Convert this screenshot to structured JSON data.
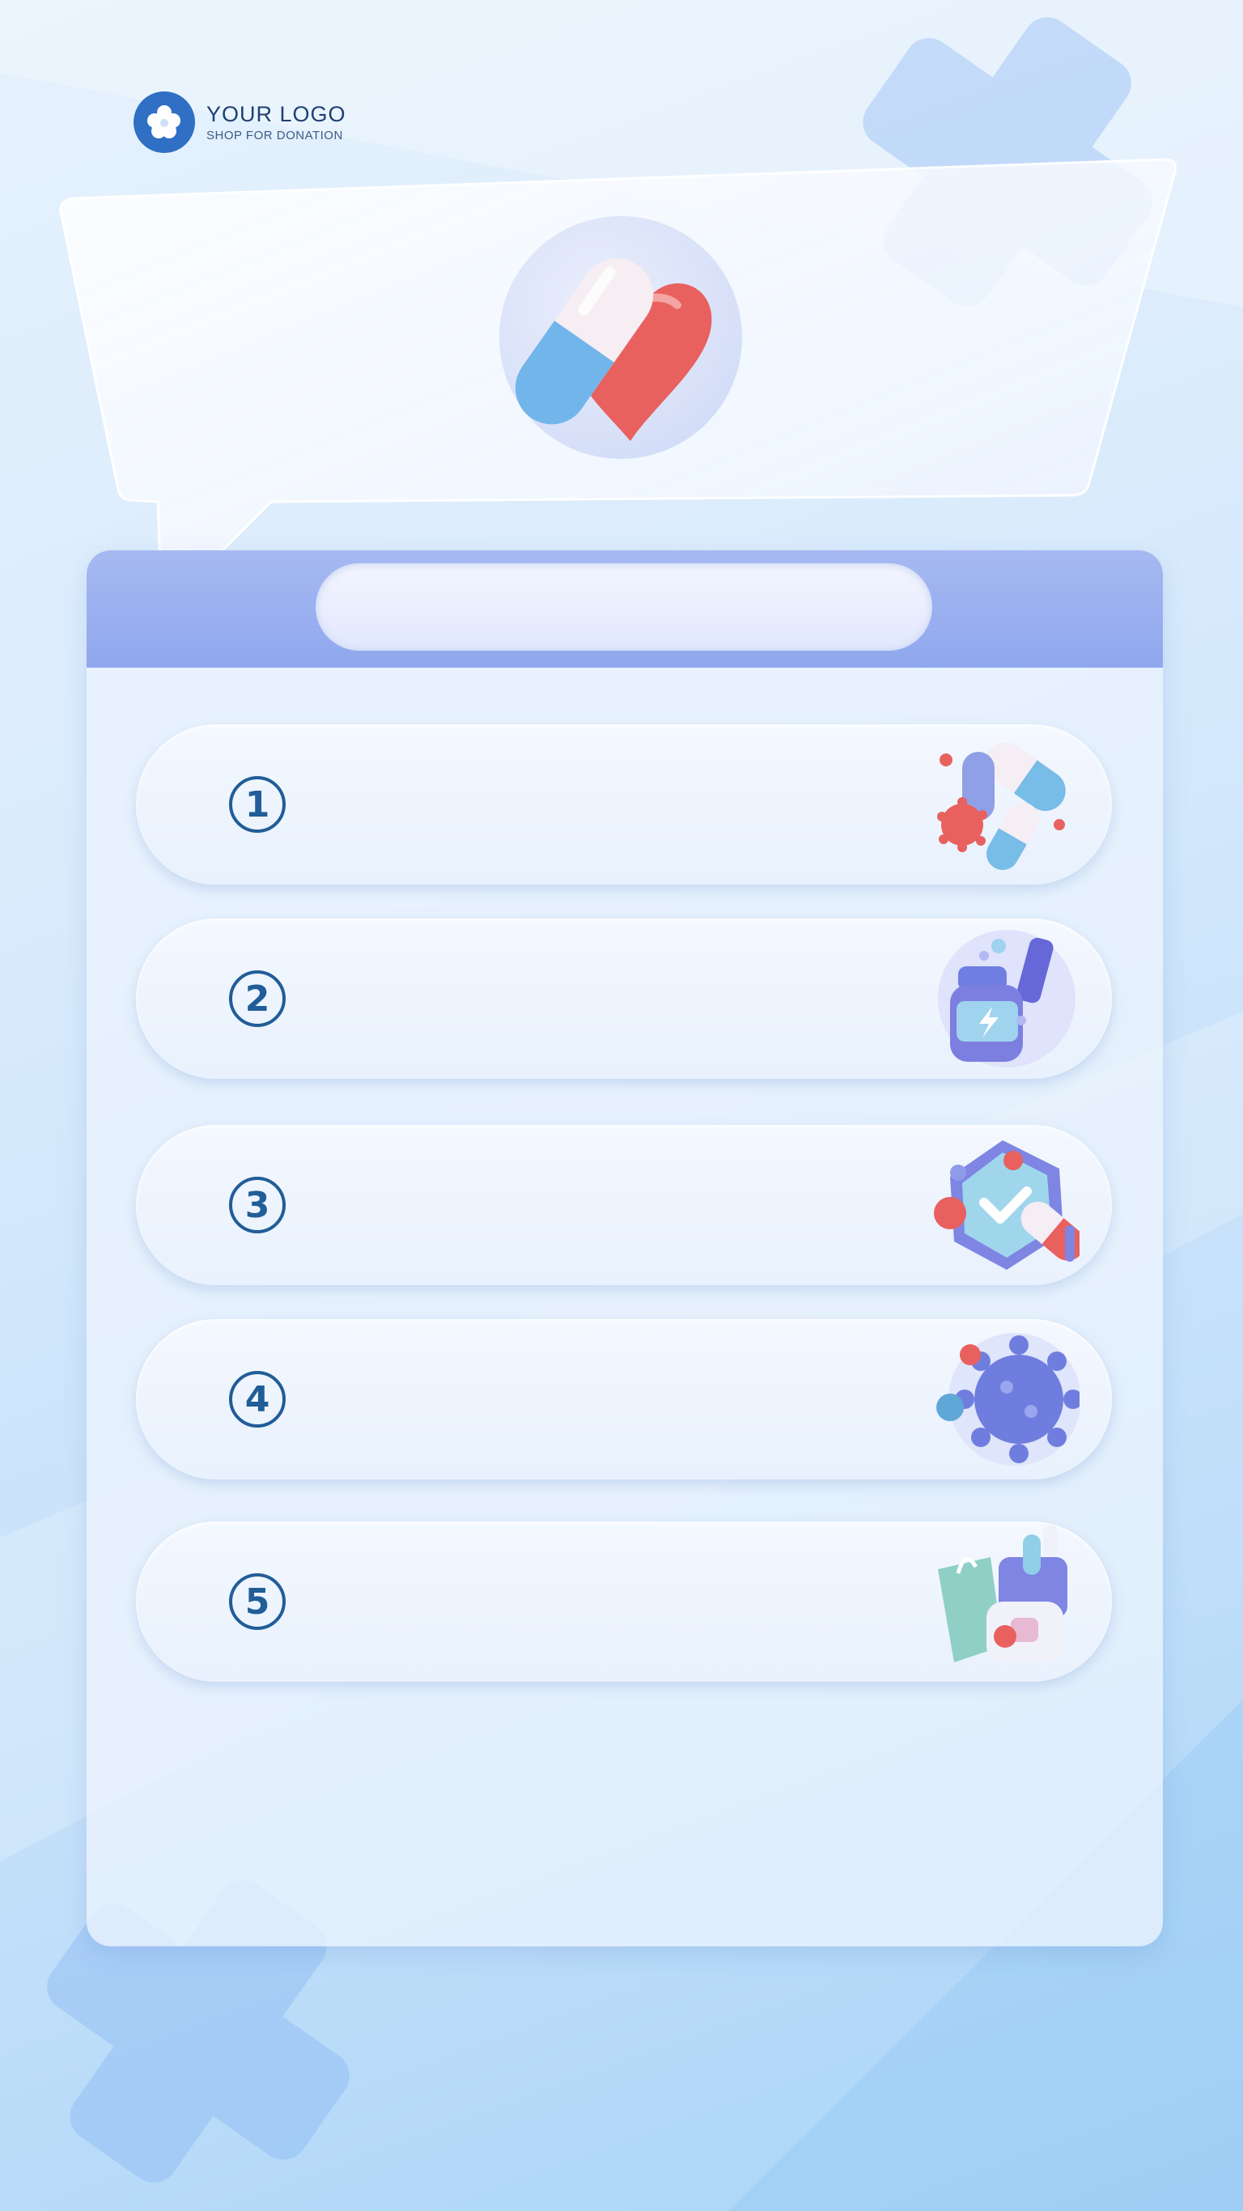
{
  "logo": {
    "title": "YOUR LOGO",
    "subtitle": "SHOP FOR DONATION"
  },
  "hero": {
    "icon": "pill-and-heart-icon"
  },
  "header": {
    "title": ""
  },
  "list": {
    "items": [
      {
        "number": "1",
        "text": "",
        "icon": "capsules-virus-icon"
      },
      {
        "number": "2",
        "text": "",
        "icon": "medicine-bottle-icon"
      },
      {
        "number": "3",
        "text": "",
        "icon": "shield-check-pill-icon"
      },
      {
        "number": "4",
        "text": "",
        "icon": "virus-icon"
      },
      {
        "number": "5",
        "text": "",
        "icon": "shopping-bag-medicine-icon"
      }
    ]
  },
  "colors": {
    "accent": "#2f6fc4",
    "header": "#8fa7ee",
    "number": "#215d98",
    "heart": "#e8615f",
    "pill": "#6fb2e8"
  }
}
